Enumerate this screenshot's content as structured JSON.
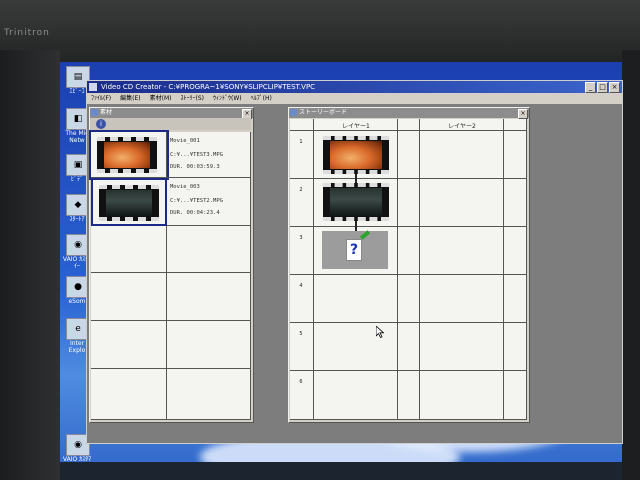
{
  "monitor": {
    "brand": "Trinitron"
  },
  "desktop": {
    "icons": [
      {
        "label": "ｴﾋﾟｰｺ",
        "icon": "notebook-icon"
      },
      {
        "label": "The Mic Netw",
        "icon": "network-icon"
      },
      {
        "label": "ﾋﾞﾃﾞ",
        "icon": "video-icon"
      },
      {
        "label": "ｽﾀｰﾄｱ",
        "icon": "start-icon"
      },
      {
        "label": "VAIO ｶｽﾀﾏｲｰ",
        "icon": "vaio-icon"
      },
      {
        "label": "eSom",
        "icon": "app-icon"
      },
      {
        "label": "Inter Explo",
        "icon": "ie-icon"
      },
      {
        "label": "VAIO ｶｽﾀﾏｲｰ",
        "icon": "vaio-icon"
      }
    ]
  },
  "app": {
    "title": "Video CD  Creator - C:¥PROGRA~1¥SONY¥SLIPCLIP¥TEST.VPC",
    "menu": [
      "ﾌｧｲﾙ(F)",
      "編集(E)",
      "素材(M)",
      "ｽﾄｰﾘｰ(S)",
      "ｳｨﾝﾄﾞｳ(W)",
      "ﾍﾙﾌﾟ(H)"
    ],
    "window_buttons": [
      "_",
      "□",
      "×"
    ]
  },
  "materials": {
    "title": "素材",
    "close": "×",
    "items": [
      {
        "name": "Movie_001",
        "path": "C:¥...¥TEST3.MPG",
        "duration": "DUR. 00:03:59.3",
        "thumb": "orange"
      },
      {
        "name": "Movie_003",
        "path": "C:¥...¥TEST2.MPG",
        "duration": "DUR. 00:04:23.4",
        "thumb": "dark"
      }
    ]
  },
  "storyboard": {
    "title": "ストーリーボード",
    "close": "×",
    "layers": [
      "レイヤー1",
      "レイヤー2"
    ],
    "rows": [
      "1",
      "2",
      "3",
      "4",
      "5",
      "6"
    ],
    "unknown_symbol": "?"
  }
}
